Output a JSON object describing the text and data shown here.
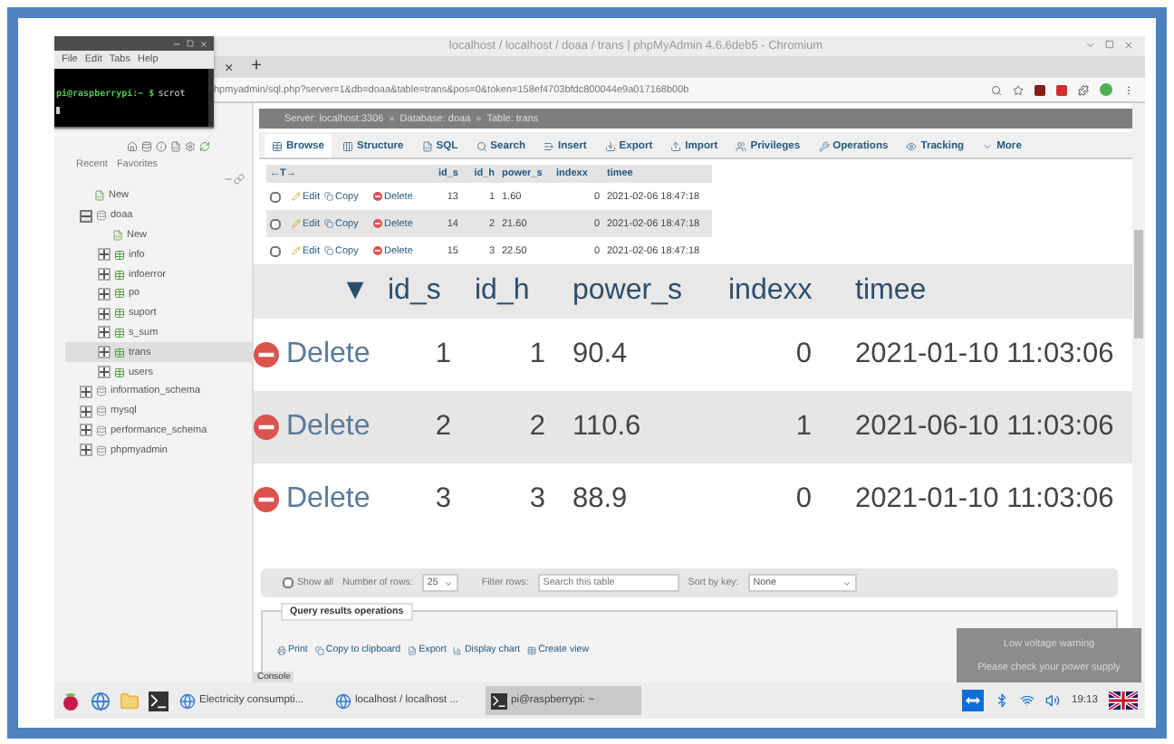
{
  "browser": {
    "title": "localhost / localhost / doaa / trans | phpMyAdmin 4.6.6deb5 - Chromium",
    "tab_close": "×",
    "new_tab": "+",
    "url": "hpmyadmin/sql.php?server=1&db=doaa&table=trans&pos=0&token=158ef4703bfdc800044e9a017168b00b"
  },
  "terminal": {
    "menu": [
      "File",
      "Edit",
      "Tabs",
      "Help"
    ],
    "prompt": "pi@raspberrypi:~ $",
    "command": "scrot"
  },
  "sidebar": {
    "links": [
      "Recent",
      "Favorites"
    ],
    "tree": [
      {
        "label": "New",
        "kind": "new",
        "selected": false
      },
      {
        "label": "doaa",
        "kind": "database",
        "selected": false,
        "expanded": true,
        "children": [
          {
            "label": "New",
            "kind": "new",
            "selected": false
          },
          {
            "label": "info",
            "kind": "table",
            "selected": false,
            "expanded": false
          },
          {
            "label": "infoerror",
            "kind": "table",
            "selected": false,
            "expanded": false
          },
          {
            "label": "po",
            "kind": "table",
            "selected": false,
            "expanded": false
          },
          {
            "label": "suport",
            "kind": "table",
            "selected": false,
            "expanded": false
          },
          {
            "label": "s_sum",
            "kind": "table",
            "selected": false,
            "expanded": false
          },
          {
            "label": "trans",
            "kind": "table",
            "selected": true,
            "expanded": false
          },
          {
            "label": "users",
            "kind": "table",
            "selected": false,
            "expanded": false
          }
        ]
      },
      {
        "label": "information_schema",
        "kind": "database",
        "selected": false,
        "expanded": false
      },
      {
        "label": "mysql",
        "kind": "database",
        "selected": false,
        "expanded": false
      },
      {
        "label": "performance_schema",
        "kind": "database",
        "selected": false,
        "expanded": false
      },
      {
        "label": "phpmyadmin",
        "kind": "database",
        "selected": false,
        "expanded": false
      }
    ]
  },
  "breadcrumb": {
    "separator": "»",
    "items": [
      "Server: localhost:3306",
      "Database: doaa",
      "Table: trans"
    ]
  },
  "tabs": [
    {
      "label": "Browse",
      "selected": true
    },
    {
      "label": "Structure",
      "selected": false
    },
    {
      "label": "SQL",
      "selected": false
    },
    {
      "label": "Search",
      "selected": false
    },
    {
      "label": "Insert",
      "selected": false
    },
    {
      "label": "Export",
      "selected": false
    },
    {
      "label": "Import",
      "selected": false
    },
    {
      "label": "Privileges",
      "selected": false
    },
    {
      "label": "Operations",
      "selected": false
    },
    {
      "label": "Tracking",
      "selected": false
    },
    {
      "label": "More",
      "selected": false
    }
  ],
  "table": {
    "sort_arrows": "←T→",
    "columns": [
      "id_s",
      "id_h",
      "power_s",
      "indexx",
      "timee"
    ],
    "rows": [
      {
        "checked": false,
        "actions": [
          "Edit",
          "Copy",
          "Delete"
        ],
        "cells": [
          "13",
          "1",
          "1.60",
          "0",
          "2021-02-06 18:47:18"
        ]
      },
      {
        "checked": false,
        "actions": [
          "Edit",
          "Copy",
          "Delete"
        ],
        "cells": [
          "14",
          "2",
          "21.60",
          "0",
          "2021-02-06 18:47:18"
        ]
      },
      {
        "checked": false,
        "actions": [
          "Edit",
          "Copy",
          "Delete"
        ],
        "cells": [
          "15",
          "3",
          "22.50",
          "0",
          "2021-02-06 18:47:18"
        ]
      }
    ]
  },
  "zoom_view": {
    "sort": "▼",
    "columns": [
      "id_s",
      "id_h",
      "power_s",
      "indexx",
      "timee"
    ],
    "rows": [
      {
        "action": "Delete",
        "cells": [
          "1",
          "1",
          "90.4",
          "0",
          "2021-01-10 11:03:06"
        ]
      },
      {
        "action": "Delete",
        "cells": [
          "2",
          "2",
          "110.6",
          "1",
          "2021-06-10 11:03:06"
        ]
      },
      {
        "action": "Delete",
        "cells": [
          "3",
          "3",
          "88.9",
          "0",
          "2021-01-10 11:03:06"
        ]
      }
    ]
  },
  "controls": {
    "show_all": {
      "label": "Show all",
      "checked": false
    },
    "rows_label": "Number of rows:",
    "rows_value": "25",
    "filter_label": "Filter rows:",
    "filter_placeholder": "Search this table",
    "sort_label": "Sort by key:",
    "sort_value": "None"
  },
  "query_ops": {
    "title": "Query results operations",
    "actions": [
      "Print",
      "Copy to clipboard",
      "Export",
      "Display chart",
      "Create view"
    ]
  },
  "console": "Console",
  "taskbar": {
    "tasks": [
      {
        "label": "Electricity consumpti...",
        "kind": "browser",
        "selected": false
      },
      {
        "label": "localhost / localhost ...",
        "kind": "browser",
        "selected": false
      },
      {
        "label": "pi@raspberrypi: ~",
        "kind": "terminal",
        "selected": true
      }
    ],
    "clock": "19:13"
  },
  "notification": {
    "title": "Low voltage warning",
    "message": "Please check your power supply"
  }
}
